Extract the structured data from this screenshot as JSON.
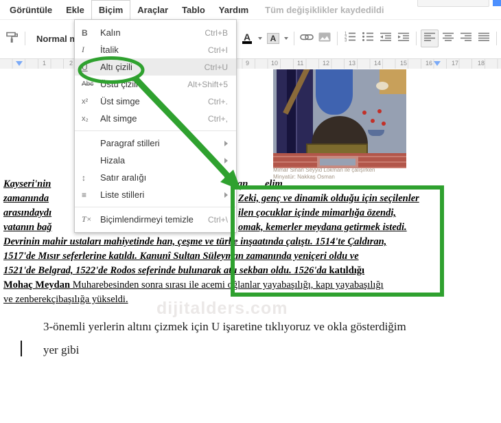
{
  "colors": {
    "annotation_green": "#2fa12f",
    "share_button_blue": "#4d90fe",
    "indent_marker_blue": "#7baaf7"
  },
  "menubar": {
    "items": [
      "Görüntüle",
      "Ekle",
      "Biçim",
      "Araçlar",
      "Tablo",
      "Yardım"
    ],
    "active_item": "Biçim",
    "status": "Tüm değişiklikler kaydedildi"
  },
  "toolbar": {
    "style_selector": "Normal me...",
    "text_color_label": "A",
    "highlight_color_label": "A"
  },
  "ruler": {
    "marks": [
      "1",
      "2",
      "9",
      "10",
      "11",
      "12",
      "13",
      "14",
      "15",
      "16",
      "17",
      "18"
    ]
  },
  "format_menu": {
    "items": [
      {
        "glyph": "B",
        "label": "Kalın",
        "shortcut": "Ctrl+B"
      },
      {
        "glyph": "I",
        "label": "İtalik",
        "shortcut": "Ctrl+I"
      },
      {
        "glyph": "U",
        "label": "Altı çizili",
        "shortcut": "Ctrl+U"
      },
      {
        "glyph": "Abc",
        "label": "Üstü çizili",
        "shortcut": "Alt+Shift+5"
      },
      {
        "glyph": "x²",
        "label": "Üst simge",
        "shortcut": "Ctrl+."
      },
      {
        "glyph": "x₂",
        "label": "Alt simge",
        "shortcut": "Ctrl+,"
      },
      {
        "glyph": "",
        "label": "Paragraf stilleri"
      },
      {
        "glyph": "",
        "label": "Hizala"
      },
      {
        "glyph": "↕",
        "label": "Satır aralığı"
      },
      {
        "glyph": "≡",
        "label": "Liste stilleri"
      },
      {
        "glyph": "T×",
        "label": "Biçimlendirmeyi temizle",
        "shortcut": "Ctrl+\\"
      }
    ]
  },
  "document": {
    "image_caption": {
      "line1": "Mimar Sinan Seyyid Lokman ile çalışırken",
      "line2": "Minyatür: Nakkaş Osman"
    },
    "lines": {
      "l1_left": "Kayseri'nin",
      "l1_mid": "an",
      "l1_right": "elim",
      "l2_left": "zamanında",
      "l2_right": "Zeki, genç ve dinamik olduğu için seçilenler",
      "l3_left": "arasındaydı",
      "l3_right": "ilen çocuklar içinde mimarlığa özendi,",
      "l4_left": "vatanın bağ",
      "l4_right": "omak, kemerler meydana getirmek istedi.",
      "l5": "Devrinin mahir ustaları mahiyetinde han, çeşme ve türbe inşaatında çalıştı. 1514'te Çaldıran,",
      "l6": "1517'de Mısır seferlerine katıldı. Kanunî Sultan Süleyman zamanında yeniçeri oldu ve",
      "l7_italic": "1521'de Belgrad, 1522'de Rodos seferinde bulunarak atlı sekban oldu. 1526'da ",
      "l7_bold": "katıldığı",
      "l8_bold": "Mohaç Meydan",
      "l8_rest": " Muharebesinden sonra sırası ile acemi oğlanlar yayabaşılığı, kapı yayabaşılığı",
      "l9": "ve zenberekçibaşılığa yükseldi."
    },
    "watermark": "dijitalders.com",
    "paragraph": {
      "line1": "3-önemli yerlerin altını çizmek için U işaretine tıklıyoruz ve okla gösterdiğim",
      "line2": "yer gibi"
    }
  }
}
